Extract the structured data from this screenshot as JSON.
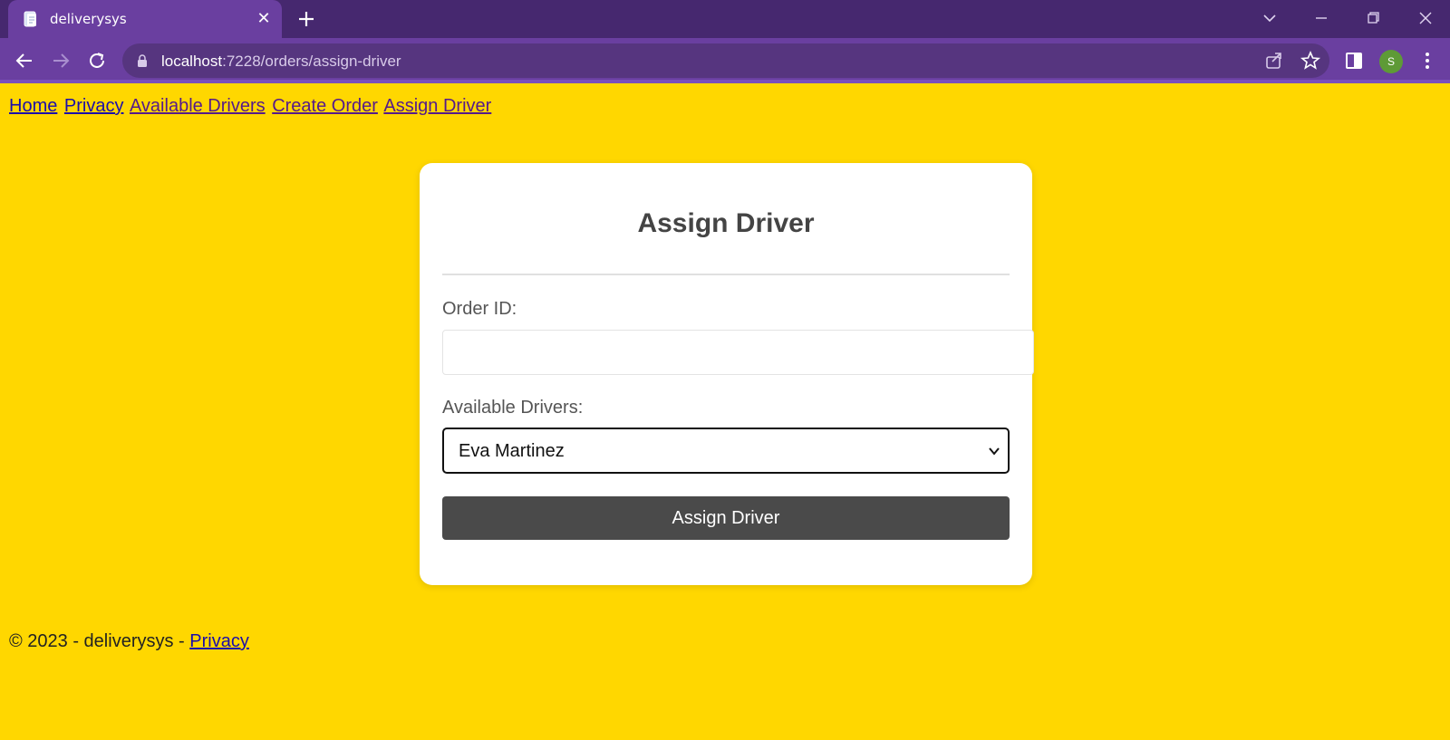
{
  "browser": {
    "tab_title": "deliverysys",
    "url_host": "localhost",
    "url_path": ":7228/orders/assign-driver",
    "profile_initial": "S"
  },
  "nav": {
    "items": [
      "Home",
      "Privacy",
      "Available Drivers",
      "Create Order",
      "Assign Driver"
    ]
  },
  "form": {
    "title": "Assign Driver",
    "order_id_label": "Order ID:",
    "order_id_value": "",
    "drivers_label": "Available Drivers:",
    "drivers_selected": "Eva Martinez",
    "submit_label": "Assign Driver"
  },
  "footer": {
    "text": "© 2023 - deliverysys - ",
    "privacy_link": "Privacy"
  },
  "colors": {
    "page_background": "#ffd700",
    "browser_frame": "#46286f",
    "browser_toolbar": "#6a3fa0",
    "button": "#4a4a4a",
    "link": "#1a0dab"
  }
}
